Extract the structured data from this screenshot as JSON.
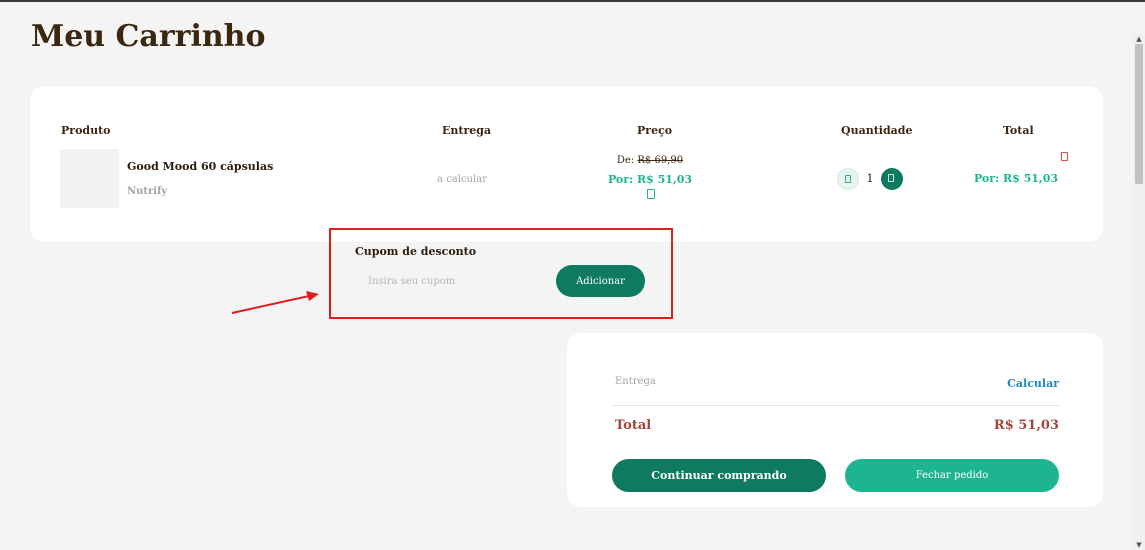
{
  "page": {
    "title": "Meu Carrinho"
  },
  "cart": {
    "headers": {
      "product": "Produto",
      "delivery": "Entrega",
      "price": "Preço",
      "quantity": "Quantidade",
      "total": "Total"
    },
    "items": [
      {
        "name": "Good Mood 60 cápsulas",
        "brand": "Nutrify",
        "delivery": "a calcular",
        "price_old_prefix": "De:",
        "price_old": "R$ 69,90",
        "price_new": "Por: R$ 51,03",
        "quantity": "1",
        "total": "Por: R$ 51,03"
      }
    ]
  },
  "coupon": {
    "label": "Cupom de desconto",
    "placeholder": "Insira seu cupom",
    "button_label": "Adicionar"
  },
  "summary": {
    "delivery_label": "Entrega",
    "calc_link": "Calcular",
    "total_label": "Total",
    "total_value": "R$ 51,03",
    "continue_label": "Continuar comprando",
    "close_label": "Fechar pedido"
  },
  "colors": {
    "primary_dark": "#0e7a5f",
    "primary_light": "#1db58f",
    "title_brown": "#3b2610",
    "total_red": "#a2463a",
    "link_blue": "#1a8bbf",
    "highlight_red": "#e21d1d"
  }
}
